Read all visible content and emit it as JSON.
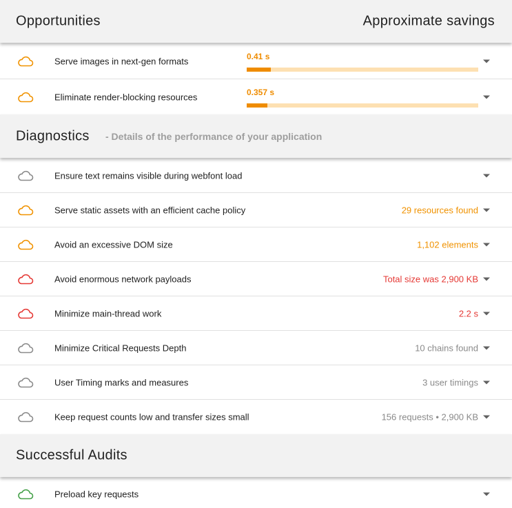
{
  "colors": {
    "orange": "#f09200",
    "red": "#e53935",
    "gray": "#8a8a8a",
    "green": "#43a047",
    "bar_fill": "#ef8c00",
    "bar_track": "#fde0b2"
  },
  "opportunities": {
    "title": "Opportunities",
    "right_title": "Approximate savings",
    "items": [
      {
        "label": "Serve images in next-gen formats",
        "savings": "0.41 s",
        "savings_fraction": 0.105,
        "icon": "cloud-icon",
        "status": "orange"
      },
      {
        "label": "Eliminate render-blocking resources",
        "savings": "0.357 s",
        "savings_fraction": 0.089,
        "icon": "cloud-icon",
        "status": "orange"
      }
    ]
  },
  "diagnostics": {
    "title": "Diagnostics",
    "subtitle": "- Details of the performance of your application",
    "items": [
      {
        "label": "Ensure text remains visible during webfont load",
        "value": "",
        "icon": "cloud-icon",
        "status": "gray"
      },
      {
        "label": "Serve static assets with an efficient cache policy",
        "value": "29 resources found",
        "icon": "cloud-icon",
        "status": "orange"
      },
      {
        "label": "Avoid an excessive DOM size",
        "value": "1,102 elements",
        "icon": "cloud-icon",
        "status": "orange"
      },
      {
        "label": "Avoid enormous network payloads",
        "value": "Total size was 2,900 KB",
        "icon": "cloud-icon",
        "status": "red"
      },
      {
        "label": "Minimize main-thread work",
        "value": "2.2 s",
        "icon": "cloud-icon",
        "status": "red"
      },
      {
        "label": "Minimize Critical Requests Depth",
        "value": "10 chains found",
        "icon": "cloud-icon",
        "status": "gray"
      },
      {
        "label": "User Timing marks and measures",
        "value": "3 user timings",
        "icon": "cloud-icon",
        "status": "gray"
      },
      {
        "label": "Keep request counts low and transfer sizes small",
        "value": "156 requests • 2,900 KB",
        "icon": "cloud-icon",
        "status": "gray"
      }
    ]
  },
  "successful_audits": {
    "title": "Successful Audits",
    "items": [
      {
        "label": "Preload key requests",
        "value": "",
        "icon": "cloud-icon",
        "status": "green"
      }
    ]
  }
}
